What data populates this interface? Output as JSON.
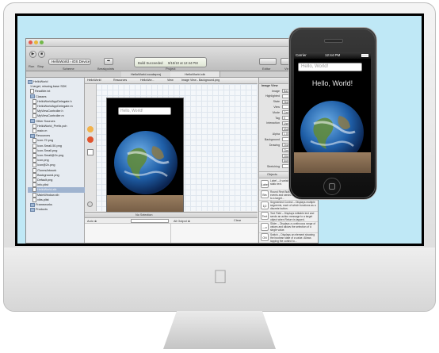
{
  "xcode": {
    "scheme": "HelloWorld › iOS Device",
    "toolbar_labels": {
      "run": "Run",
      "stop": "Stop",
      "scheme": "Scheme",
      "breakpoints": "Breakpoints",
      "editor": "Editor",
      "view": "View",
      "organizer": "Organizer"
    },
    "tabs": [
      "HelloWorld.xcodeproj",
      "HelloWorld.xib"
    ],
    "activity": {
      "status": "Build Succeeded",
      "time": "9/15/10 at 12:44 PM",
      "project": "Project"
    },
    "jumpbar": [
      "HelloWorld",
      "Resources",
      "HelloWor...",
      "View",
      "Image View - Background.png"
    ],
    "navigator": [
      {
        "label": "HelloWorld",
        "type": "folder",
        "indent": 0
      },
      {
        "label": "1 target, missing base SDK",
        "type": "meta",
        "indent": 1
      },
      {
        "label": "ReadMe.txt",
        "type": "file",
        "indent": 1
      },
      {
        "label": "Classes",
        "type": "folder",
        "indent": 1
      },
      {
        "label": "HelloWorldAppDelegate.h",
        "type": "file",
        "indent": 2
      },
      {
        "label": "HelloWorldAppDelegate.m",
        "type": "file",
        "indent": 2
      },
      {
        "label": "MyViewController.h",
        "type": "file",
        "indent": 2
      },
      {
        "label": "MyViewController.m",
        "type": "file",
        "indent": 2
      },
      {
        "label": "Other Sources",
        "type": "folder",
        "indent": 1
      },
      {
        "label": "HelloWorld_Prefix.pch",
        "type": "file",
        "indent": 2
      },
      {
        "label": "main.m",
        "type": "file",
        "indent": 2
      },
      {
        "label": "Resources",
        "type": "folder",
        "indent": 1
      },
      {
        "label": "Icon-72.png",
        "type": "file",
        "indent": 2
      },
      {
        "label": "Icon-Small-50.png",
        "type": "file",
        "indent": 2
      },
      {
        "label": "Icon-Small.png",
        "type": "file",
        "indent": 2
      },
      {
        "label": "Icon-Small@2x.png",
        "type": "file",
        "indent": 2
      },
      {
        "label": "Icon.png",
        "type": "file",
        "indent": 2
      },
      {
        "label": "Icon@2x.png",
        "type": "file",
        "indent": 2
      },
      {
        "label": "iTunesArtwork",
        "type": "file",
        "indent": 2
      },
      {
        "label": "Background.png",
        "type": "file",
        "indent": 2
      },
      {
        "label": "Default.png",
        "type": "file",
        "indent": 2
      },
      {
        "label": "Info.plist",
        "type": "file",
        "indent": 2
      },
      {
        "label": "HelloWorld.xib",
        "type": "file",
        "indent": 2,
        "selected": true
      },
      {
        "label": "MainWindow.xib",
        "type": "file",
        "indent": 2
      },
      {
        "label": "xibs.plist",
        "type": "file",
        "indent": 2
      },
      {
        "label": "Frameworks",
        "type": "folder",
        "indent": 1
      },
      {
        "label": "Products",
        "type": "folder",
        "indent": 1
      }
    ],
    "ib_view": {
      "field_placeholder": "Hello, World!"
    },
    "debug": {
      "selection": "No Selection",
      "auto": "Auto ≑",
      "all_output": "All Output ≑",
      "clear": "Clear"
    },
    "inspector": {
      "section": "Image View",
      "rows": [
        {
          "label": "Image",
          "value": "Backgro..."
        },
        {
          "label": "Highlighted",
          "value": ""
        },
        {
          "label": "State",
          "value": "Highlighted"
        },
        {
          "label": "View",
          "value": ""
        },
        {
          "label": "Mode",
          "value": "Center"
        },
        {
          "label": "Tag",
          "value": "0"
        },
        {
          "label": "Interaction",
          "value": "User I..."
        },
        {
          "label": "",
          "value": "Multip..."
        },
        {
          "label": "Alpha",
          "value": "1.00"
        },
        {
          "label": "Background",
          "value": ""
        },
        {
          "label": "Drawing",
          "value": "Opaque"
        },
        {
          "label": "",
          "value": "Clears"
        },
        {
          "label": "",
          "value": "Clip Su..."
        },
        {
          "label": "",
          "value": "Autore..."
        },
        {
          "label": "Stretching",
          "value": ""
        }
      ],
      "library_tab": "Objects",
      "library": [
        {
          "icon": "Label",
          "title": "Label",
          "desc": "Label – A variably sized amount of static text."
        },
        {
          "icon": "Btn",
          "title": "Round Rect Button",
          "desc": "Round Rect Button – Intercepts touch events and sends an action message to a target..."
        },
        {
          "icon": "1|2",
          "title": "Segmented Control",
          "desc": "Segmented Control – Displays multiple segments, each of which functions as a discrete button."
        },
        {
          "icon": "Text",
          "title": "Text Field",
          "desc": "Text Field – Displays editable text and sends an action message to a target object when Return is tapped."
        },
        {
          "icon": "—o",
          "title": "Slider",
          "desc": "Slider – Displays a continuous range of values and allows the selection of a single value."
        },
        {
          "icon": "ON",
          "title": "Switch",
          "desc": "Switch – Displays an element showing the boolean state of a value. Allows tapping the control to..."
        }
      ]
    }
  },
  "iphone": {
    "carrier": "Carrier",
    "time": "12:44 PM",
    "field_placeholder": "Hello, World!",
    "label": "Hello, World!"
  },
  "colors": {
    "desktop": "#bfe8f6",
    "selection": "#9fb3cf",
    "ocean": "#1f5fa8",
    "land": "#5f8a3c",
    "ground": "#8a6f52"
  }
}
